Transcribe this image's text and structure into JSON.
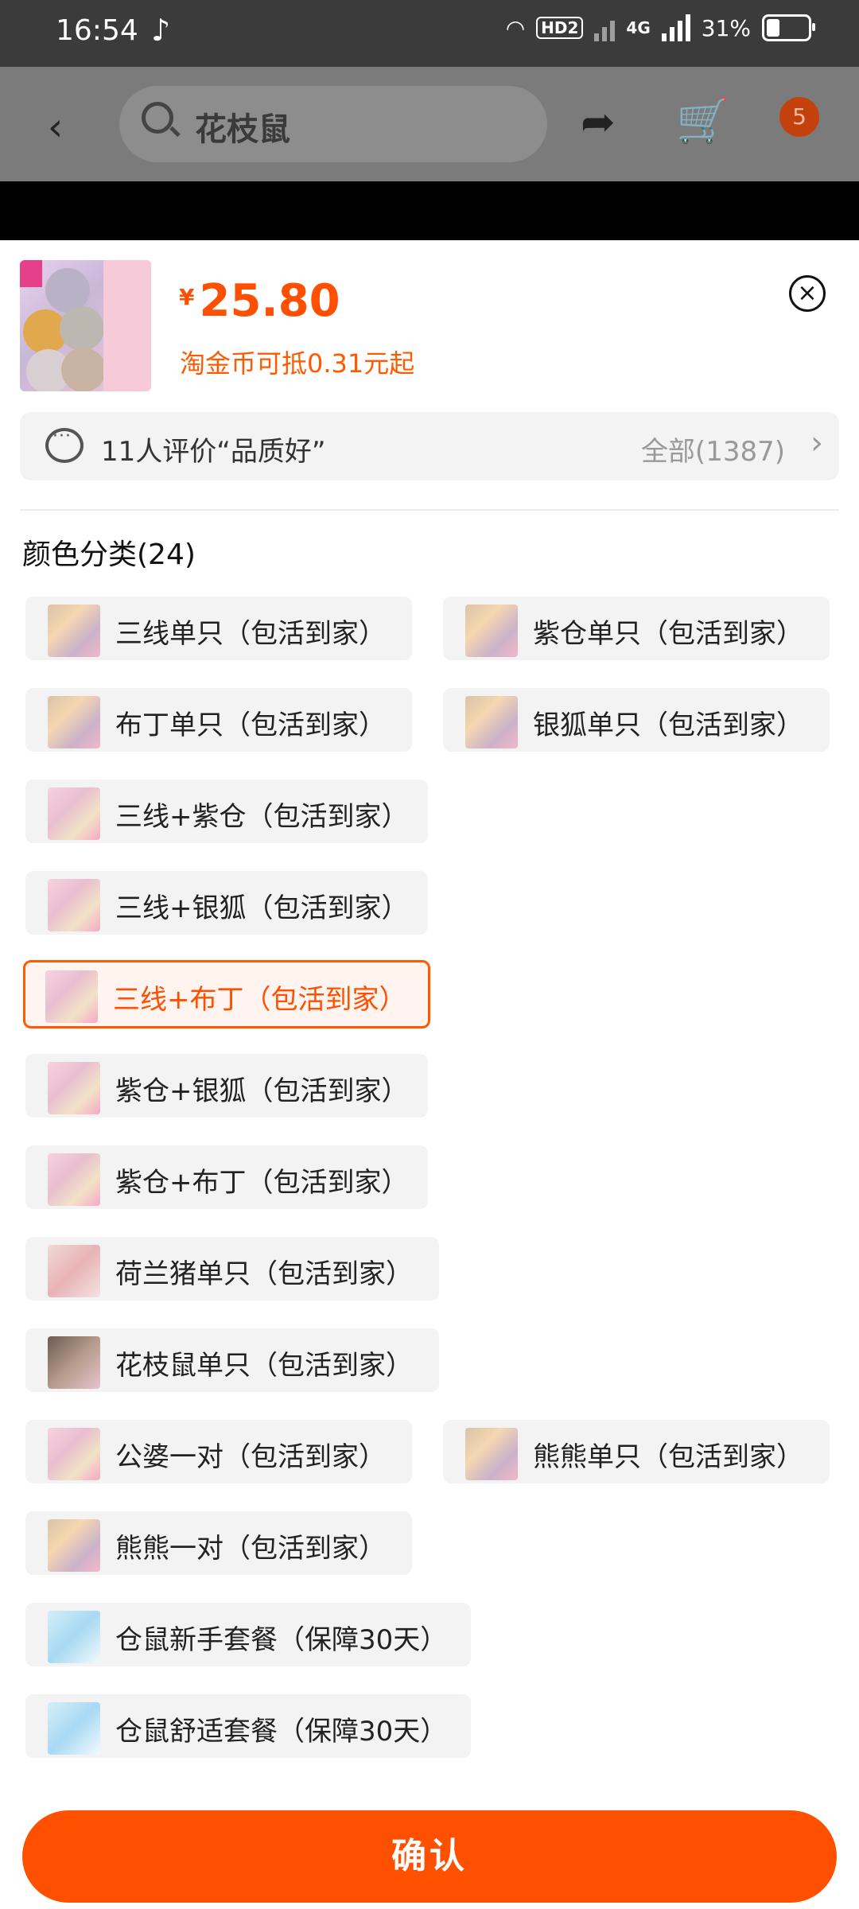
{
  "status_bar": {
    "time": "16:54",
    "network": "4G",
    "battery": "31%",
    "hd_label": "HD2",
    "battery_level": 0.31
  },
  "header": {
    "search_text": "花枝鼠",
    "cart_badge": "5"
  },
  "product": {
    "currency": "¥",
    "price": "25.80",
    "coin_note": "淘金币可抵0.31元起"
  },
  "review": {
    "summary": "11人评价“品质好”",
    "all_count": "全部(1387)"
  },
  "section": {
    "title": "颜色分类(24)"
  },
  "options": [
    {
      "label": "三线单只（包活到家）",
      "thumb": "hamster-multi",
      "selected": false
    },
    {
      "label": "紫仓单只（包活到家）",
      "thumb": "hamster-multi",
      "selected": false
    },
    {
      "label": "布丁单只（包活到家）",
      "thumb": "hamster-multi",
      "selected": false
    },
    {
      "label": "银狐单只（包活到家）",
      "thumb": "hamster-multi",
      "selected": false
    },
    {
      "label": "三线+紫仓（包活到家）",
      "thumb": "hamster-pink",
      "selected": false
    },
    {
      "label": "三线+银狐（包活到家）",
      "thumb": "hamster-pink",
      "selected": false
    },
    {
      "label": "三线+布丁（包活到家）",
      "thumb": "hamster-pink",
      "selected": true
    },
    {
      "label": "紫仓+银狐（包活到家）",
      "thumb": "hamster-pink",
      "selected": false
    },
    {
      "label": "紫仓+布丁（包活到家）",
      "thumb": "hamster-pink",
      "selected": false
    },
    {
      "label": "荷兰猪单只（包活到家）",
      "thumb": "guinea-pig",
      "selected": false
    },
    {
      "label": "花枝鼠单只（包活到家）",
      "thumb": "rat",
      "selected": false
    },
    {
      "label": "公婆一对（包活到家）",
      "thumb": "hamster-pink",
      "selected": false
    },
    {
      "label": "熊熊单只（包活到家）",
      "thumb": "hamster-multi",
      "selected": false
    },
    {
      "label": "熊熊一对（包活到家）",
      "thumb": "hamster-multi",
      "selected": false
    },
    {
      "label": "仓鼠新手套餐（保障30天）",
      "thumb": "kit",
      "selected": false
    },
    {
      "label": "仓鼠舒适套餐（保障30天）",
      "thumb": "kit",
      "selected": false
    }
  ],
  "confirm_label": "确认",
  "colors": {
    "accent": "#ff5000",
    "price": "#ff4f00"
  }
}
